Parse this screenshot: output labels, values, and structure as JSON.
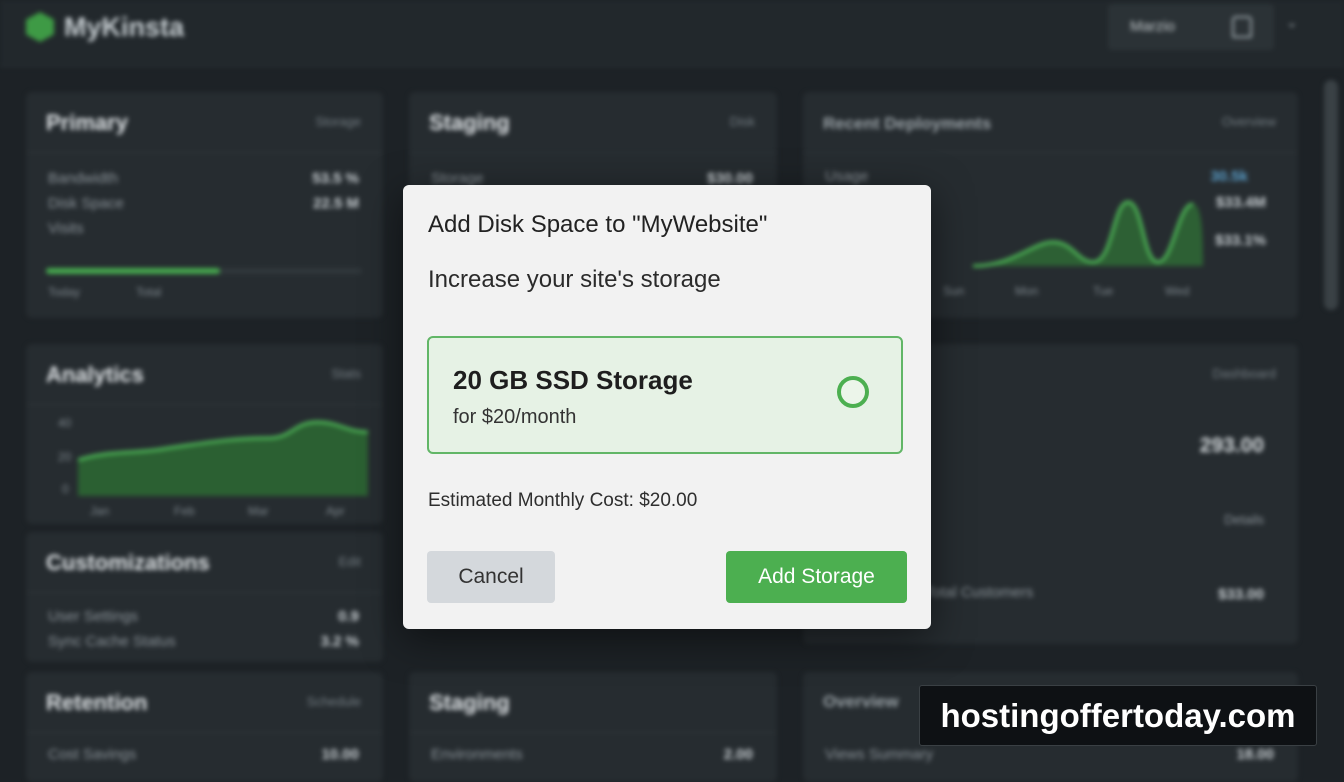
{
  "app": {
    "logo_text": "MyKinsta",
    "user_label": "Marzio",
    "icons": [
      "logo-mark-icon",
      "bell-icon",
      "chevron-down-icon",
      "radio-icon"
    ]
  },
  "background": {
    "cards": [
      {
        "title": "Primary",
        "meta": "Storage",
        "rows": [
          {
            "label": "Bandwidth",
            "value": "53.5 %"
          },
          {
            "label": "Disk Space",
            "value": "22.5 M"
          },
          {
            "label": "Visits",
            "value": ""
          }
        ],
        "progress": 0.55,
        "ticks": [
          "Today",
          "Total"
        ]
      },
      {
        "title": "Staging",
        "meta": "Disk",
        "rows": [
          {
            "label": "Storage",
            "value": "$30.00"
          }
        ]
      },
      {
        "title": "Recent Deployments",
        "meta": "Overview",
        "rows": [
          {
            "label": "Usage",
            "value": "30.5k"
          },
          {
            "label": "",
            "value": "$33.4M"
          },
          {
            "label": "",
            "value": "$33.1%"
          }
        ],
        "ticks": [
          "Sun",
          "Mon",
          "Tue",
          "Wed"
        ]
      },
      {
        "title": "Analytics",
        "meta": "Stats",
        "ticks": [
          "Jan",
          "Feb",
          "Mar",
          "Apr"
        ],
        "y_ticks": [
          "40",
          "20",
          "0"
        ]
      },
      {
        "title": "Customizations",
        "meta": "Edit",
        "rows": [
          {
            "label": "User Settings",
            "value": "0.9"
          },
          {
            "label": "Sync Cache Status",
            "value": "3.2 %"
          }
        ]
      },
      {
        "title": "",
        "meta": "Dashboard",
        "rows": [
          {
            "label": "",
            "value": "293.00"
          },
          {
            "label": "",
            "value": "Details"
          },
          {
            "label": "Total Customers",
            "value": "$33.00"
          }
        ]
      },
      {
        "title": "Retention",
        "meta": "Schedule",
        "rows": [
          {
            "label": "Cost Savings",
            "value": "10.00"
          }
        ]
      },
      {
        "title": "Staging",
        "meta": "",
        "rows": [
          {
            "label": "Environments",
            "value": "2.00"
          }
        ]
      },
      {
        "title": "Overview",
        "meta": "",
        "rows": [
          {
            "label": "Views Summary",
            "value": "18.00"
          }
        ]
      }
    ]
  },
  "modal": {
    "title": "Add Disk Space to \"MyWebsite\"",
    "subtitle": "Increase your site's storage",
    "option": {
      "name": "20 GB SSD Storage",
      "price": "for $20/month"
    },
    "estimate": "Estimated Monthly Cost: $20.00",
    "buttons": {
      "cancel": "Cancel",
      "add": "Add Storage"
    },
    "colors": {
      "accent": "#4caf50",
      "option_bg": "#e6f2e5",
      "dialog_bg": "#f2f2f2"
    }
  },
  "watermark": {
    "text": "hostingoffertoday.com"
  }
}
